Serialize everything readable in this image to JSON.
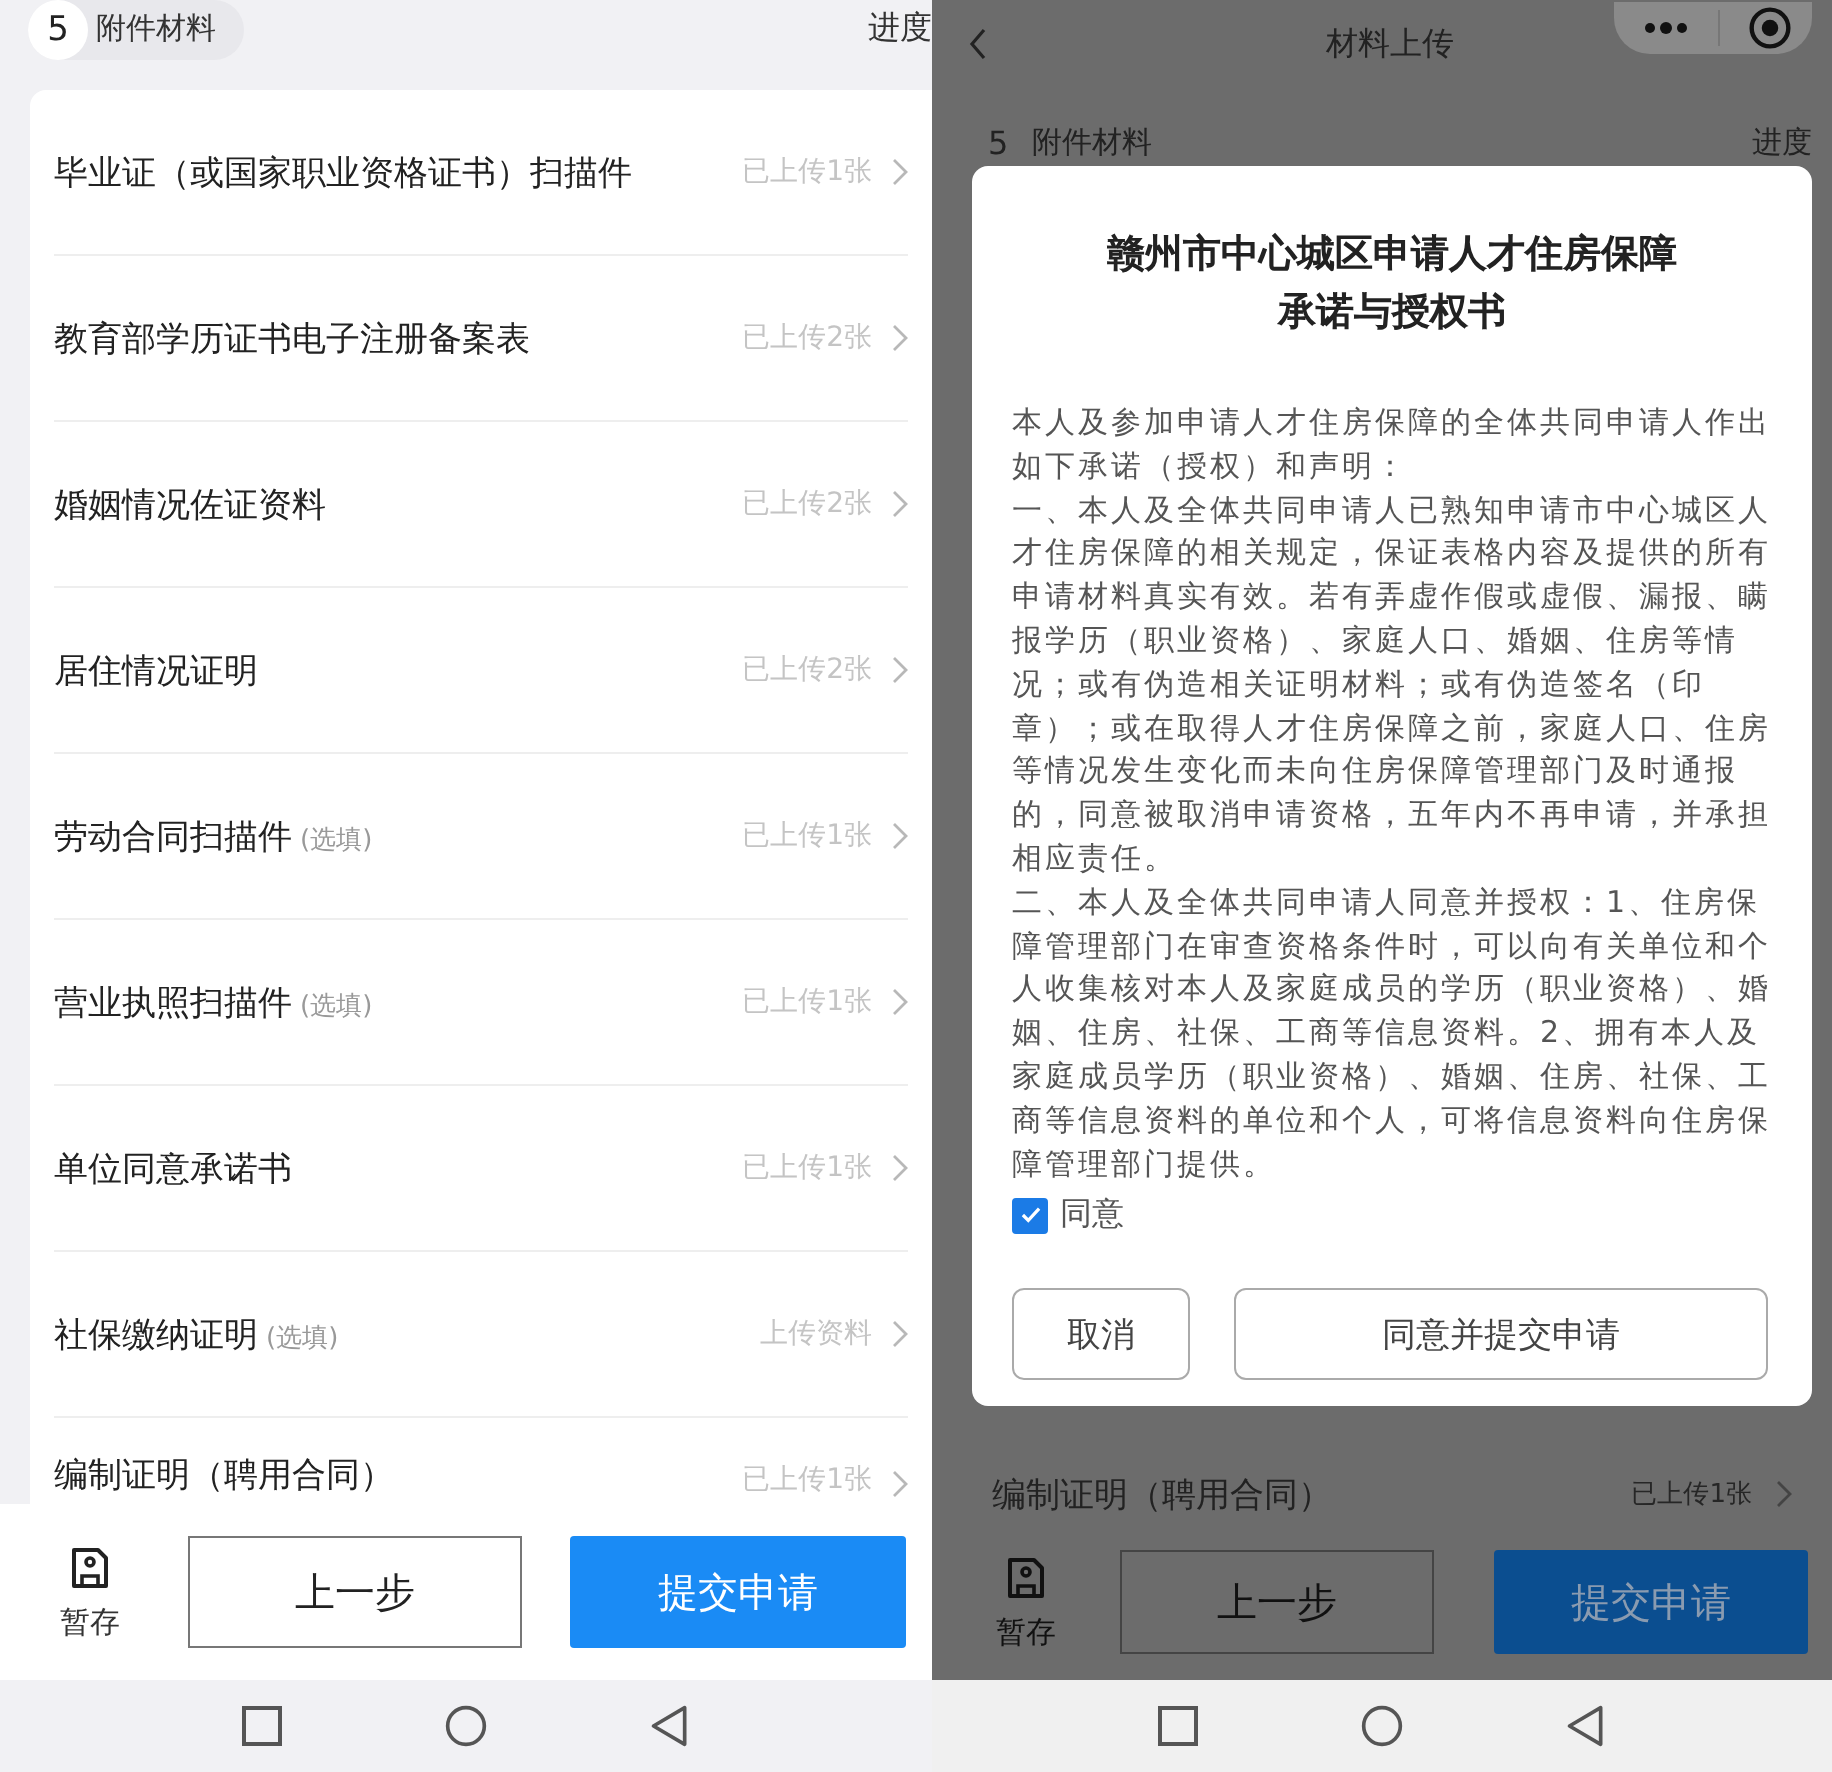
{
  "left": {
    "step": {
      "number": "5",
      "label": "附件材料"
    },
    "progress_label": "进度",
    "items": [
      {
        "name": "毕业证（或国家职业资格证书）扫描件",
        "status": "已上传1张"
      },
      {
        "name": "教育部学历证书电子注册备案表",
        "status": "已上传2张"
      },
      {
        "name": "婚姻情况佐证资料",
        "status": "已上传2张"
      },
      {
        "name": "居住情况证明",
        "status": "已上传2张"
      },
      {
        "name": "劳动合同扫描件",
        "note": "(选填)",
        "status": "已上传1张"
      },
      {
        "name": "营业执照扫描件",
        "note": "(选填)",
        "status": "已上传1张"
      },
      {
        "name": "单位同意承诺书",
        "status": "已上传1张"
      },
      {
        "name": "社保缴纳证明",
        "note": "(选填)",
        "status": "上传资料"
      },
      {
        "name": "编制证明（聘用合同）",
        "status": "已上传1张"
      }
    ],
    "bottom_bar": {
      "save_label": "暂存",
      "prev_button": "上一步",
      "submit_button": "提交申请"
    }
  },
  "right": {
    "nav_title": "材料上传",
    "step": {
      "number": "5",
      "label": "附件材料"
    },
    "progress_label": "进度",
    "dialog": {
      "title": [
        "赣州市中心城区申请人才住房保障",
        "承诺与授权书"
      ],
      "paragraphs": [
        "本人及参加申请人才住房保障的全体共同申请人作出如下承诺（授权）和声明：",
        "一、本人及全体共同申请人已熟知申请市中心城区人才住房保障的相关规定，保证表格内容及提供的所有申请材料真实有效。若有弄虚作假或虚假、漏报、瞒报学历（职业资格）、家庭人口、婚姻、住房等情况；或有伪造相关证明材料；或有伪造签名（印章）；或在取得人才住房保障之前，家庭人口、住房等情况发生变化而未向住房保障管理部门及时通报的，同意被取消申请资格，五年内不再申请，并承担相应责任。",
        "二、本人及全体共同申请人同意并授权：1、住房保障管理部门在审查资格条件时，可以向有关单位和个人收集核对本人及家庭成员的学历（职业资格）、婚姻、住房、社保、工商等信息资料。2、拥有本人及家庭成员学历（职业资格）、婚姻、住房、社保、工商等信息资料的单位和个人，可将信息资料向住房保障管理部门提供。"
      ],
      "agree": {
        "label": "同意",
        "checked": true
      },
      "cancel_button": "取消",
      "confirm_button": "同意并提交申请"
    },
    "visible_item": {
      "name": "编制证明（聘用合同）",
      "status": "已上传1张"
    },
    "bottom_bar": {
      "save_label": "暂存",
      "prev_button": "上一步",
      "submit_button": "提交申请"
    }
  }
}
